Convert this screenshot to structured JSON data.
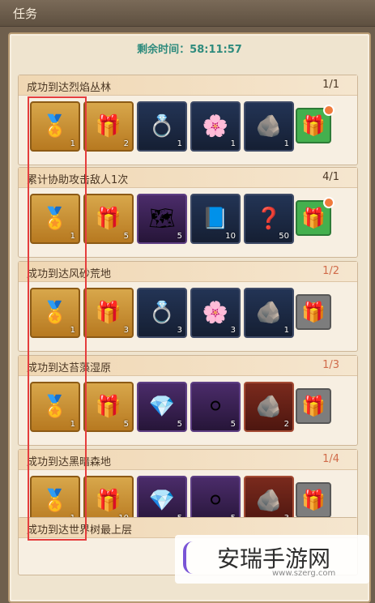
{
  "window": {
    "title": "任务"
  },
  "timer": {
    "text": "剩余时间：58:11:57"
  },
  "quests": [
    {
      "title": "成功到达烈焰丛林",
      "progress": "1/1",
      "rewards": [
        {
          "icon": "medal-icon",
          "qty": "1",
          "style": "gold"
        },
        {
          "icon": "treasure-icon",
          "qty": "2",
          "style": "gold"
        },
        {
          "icon": "ring-icon",
          "qty": "1",
          "style": "dark"
        },
        {
          "icon": "wreath-icon",
          "qty": "1",
          "style": "dark"
        },
        {
          "icon": "rune-stone-icon",
          "qty": "1",
          "style": "dark"
        }
      ],
      "gift": {
        "state": "available",
        "dot": true
      }
    },
    {
      "title": "累计协助攻击敌人1次",
      "progress": "4/1",
      "rewards": [
        {
          "icon": "medal-icon",
          "qty": "1",
          "style": "gold"
        },
        {
          "icon": "treasure-icon",
          "qty": "5",
          "style": "gold"
        },
        {
          "icon": "map-icon",
          "qty": "5",
          "style": "purple"
        },
        {
          "icon": "book-icon",
          "qty": "10",
          "style": "dark"
        },
        {
          "icon": "mystery-book-icon",
          "qty": "50",
          "style": "dark"
        }
      ],
      "gift": {
        "state": "available",
        "dot": true
      }
    },
    {
      "title": "成功到达风砂荒地",
      "progress": "1/2",
      "rewards": [
        {
          "icon": "medal-icon",
          "qty": "1",
          "style": "gold"
        },
        {
          "icon": "treasure-icon",
          "qty": "3",
          "style": "gold"
        },
        {
          "icon": "ring-icon",
          "qty": "3",
          "style": "dark"
        },
        {
          "icon": "wreath-icon",
          "qty": "3",
          "style": "dark"
        },
        {
          "icon": "rune-stone-icon",
          "qty": "1",
          "style": "dark"
        }
      ],
      "gift": {
        "state": "locked",
        "dot": false
      }
    },
    {
      "title": "成功到达苔藻湿原",
      "progress": "1/3",
      "rewards": [
        {
          "icon": "medal-icon",
          "qty": "1",
          "style": "gold"
        },
        {
          "icon": "treasure-icon",
          "qty": "5",
          "style": "gold"
        },
        {
          "icon": "gem-ring-icon",
          "qty": "5",
          "style": "purple"
        },
        {
          "icon": "pearl-necklace-icon",
          "qty": "5",
          "style": "purple"
        },
        {
          "icon": "rune-stone-icon",
          "qty": "2",
          "style": "red"
        }
      ],
      "gift": {
        "state": "locked",
        "dot": false
      }
    },
    {
      "title": "成功到达黑暗森地",
      "progress": "1/4",
      "rewards": [
        {
          "icon": "medal-icon",
          "qty": "1",
          "style": "gold"
        },
        {
          "icon": "treasure-icon",
          "qty": "10",
          "style": "gold"
        },
        {
          "icon": "gem-ring-icon",
          "qty": "5",
          "style": "purple"
        },
        {
          "icon": "pearl-necklace-icon",
          "qty": "5",
          "style": "purple"
        },
        {
          "icon": "rune-stone-icon",
          "qty": "3",
          "style": "red"
        }
      ],
      "gift": {
        "state": "locked",
        "dot": false
      }
    }
  ],
  "last_quest": {
    "title": "成功到达世界树最上层"
  },
  "watermark": {
    "text": "安瑞手游网",
    "url": "www.szerg.com"
  },
  "colors": {
    "highlight": "#e53d3d",
    "timer": "#2e8b7d",
    "gift_available": "#44b04e",
    "gift_locked": "#7d7d7d"
  }
}
